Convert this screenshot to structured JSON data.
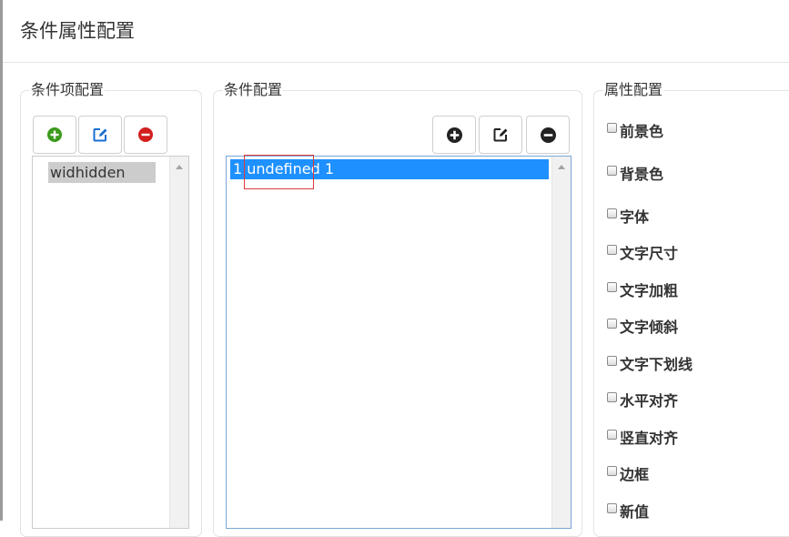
{
  "dialog": {
    "title": "条件属性配置"
  },
  "item_panel": {
    "legend": "条件项配置",
    "items": [
      {
        "label": "widhidden"
      }
    ]
  },
  "condition_panel": {
    "legend": "条件配置",
    "rows": [
      {
        "label": "1 undefined 1",
        "selected": true
      }
    ]
  },
  "attribute_panel": {
    "legend": "属性配置",
    "options": [
      {
        "label": "前景色",
        "checked": false
      },
      {
        "label": "背景色",
        "checked": false
      },
      {
        "label": "字体",
        "checked": false
      },
      {
        "label": "文字尺寸",
        "checked": false
      },
      {
        "label": "文字加粗",
        "checked": false
      },
      {
        "label": "文字倾斜",
        "checked": false
      },
      {
        "label": "文字下划线",
        "checked": false
      },
      {
        "label": "水平对齐",
        "checked": false
      },
      {
        "label": "竖直对齐",
        "checked": false
      },
      {
        "label": "边框",
        "checked": false
      },
      {
        "label": "新值",
        "checked": false
      }
    ]
  },
  "colors": {
    "add_green": "#3a9a1a",
    "edit_blue": "#1a6fd1",
    "remove_red": "#d21f1f",
    "dark_icon": "#222222",
    "selection_blue": "#1e90ff",
    "highlight_outline": "#e23a3a"
  },
  "icons": {
    "item_add": "plus-circle-icon",
    "item_edit": "edit-square-icon",
    "item_remove": "minus-circle-icon",
    "cond_add": "plus-circle-icon",
    "cond_edit": "edit-square-icon",
    "cond_remove": "minus-circle-icon"
  }
}
